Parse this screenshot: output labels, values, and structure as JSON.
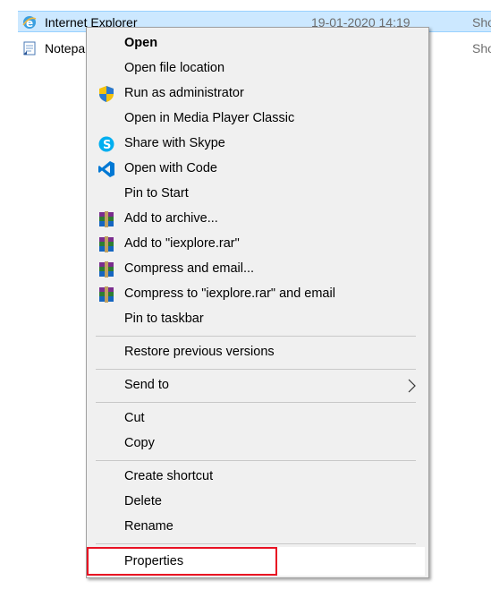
{
  "files": [
    {
      "name": "Internet Explorer",
      "date": "19-01-2020 14:19",
      "type": "Sho",
      "icon": "internet-explorer-icon"
    },
    {
      "name": "Notepa",
      "date": "",
      "type": "Sho",
      "icon": "notepad-icon"
    }
  ],
  "menu": {
    "open": "Open",
    "open_file_location": "Open file location",
    "run_as_admin": "Run as administrator",
    "open_mpc": "Open in Media Player Classic",
    "share_skype": "Share with Skype",
    "open_code": "Open with Code",
    "pin_start": "Pin to Start",
    "add_archive": "Add to archive...",
    "add_rar": "Add to \"iexplore.rar\"",
    "compress_email": "Compress and email...",
    "compress_rar_email": "Compress to \"iexplore.rar\" and email",
    "pin_taskbar": "Pin to taskbar",
    "restore_versions": "Restore previous versions",
    "send_to": "Send to",
    "cut": "Cut",
    "copy": "Copy",
    "create_shortcut": "Create shortcut",
    "delete": "Delete",
    "rename": "Rename",
    "properties": "Properties"
  },
  "colors": {
    "selection": "#cce8ff",
    "menu_bg": "#f0f0f0",
    "highlight_border": "#e81123"
  }
}
